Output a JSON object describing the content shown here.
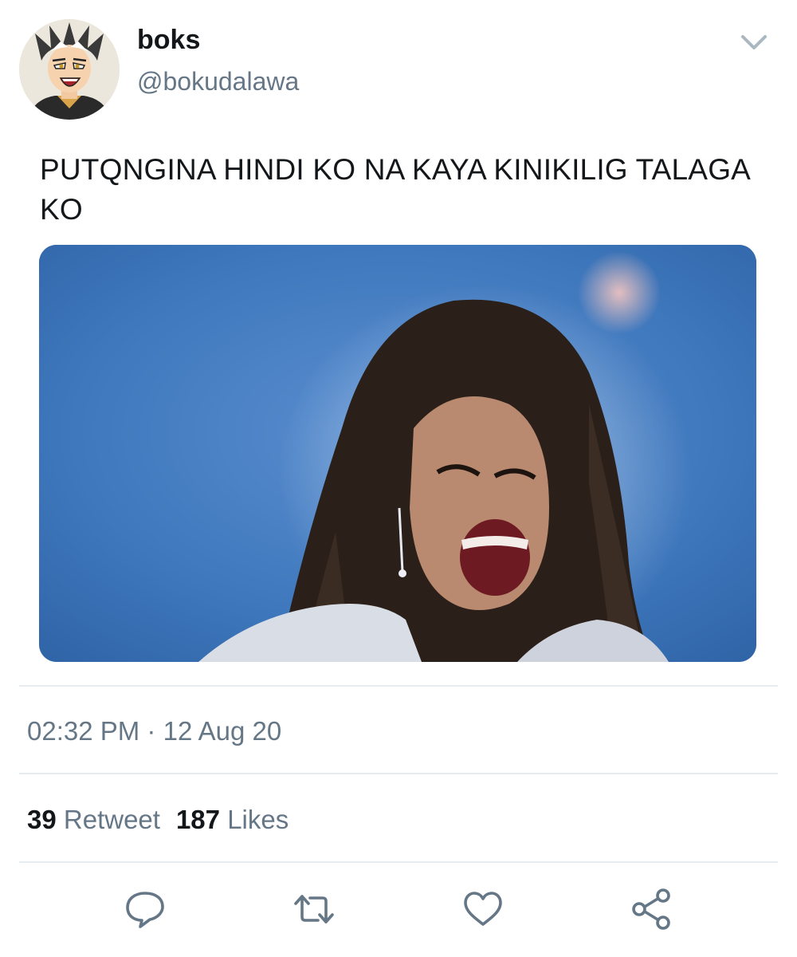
{
  "user": {
    "display_name": "boks",
    "handle": "@bokudalawa",
    "avatar_icon": "anime-avatar"
  },
  "menu": {
    "icon": "chevron-down-icon"
  },
  "tweet": {
    "text": "PUTQNGINA HINDI KO NA KAYA KINIKILIG TALAGA KO",
    "media_icon": "photo"
  },
  "meta": {
    "time": "02:32 PM",
    "separator": "·",
    "date": "12 Aug 20"
  },
  "stats": {
    "retweets": "39",
    "retweet_label": "Retweet",
    "likes": "187",
    "likes_label": "Likes"
  },
  "actions": [
    {
      "icon": "reply-icon"
    },
    {
      "icon": "retweet-icon"
    },
    {
      "icon": "like-icon"
    },
    {
      "icon": "share-icon"
    }
  ],
  "colors": {
    "text_primary": "#14171a",
    "text_secondary": "#657786",
    "icon": "#657786",
    "divider": "#e6ecf0",
    "media_background": "#3d74b7"
  }
}
